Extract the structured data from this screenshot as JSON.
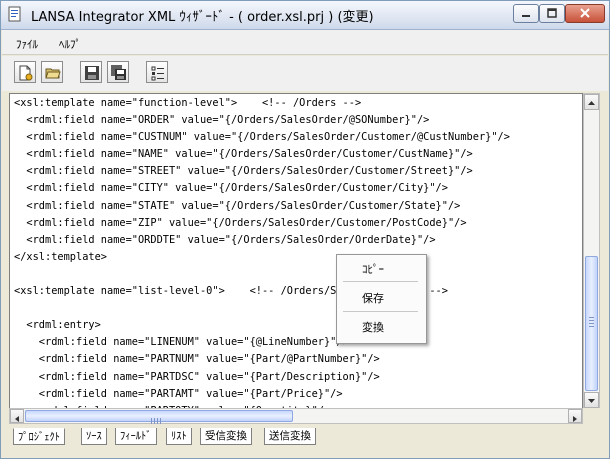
{
  "window": {
    "title": "LANSA Integrator XML ｳｨｻﾞｰﾄﾞ - ( order.xsl.prj ) (変更)"
  },
  "menu": {
    "file": "ﾌｧｲﾙ",
    "help": "ﾍﾙﾌﾟ"
  },
  "toolbar": {
    "buttons": [
      "new-project-icon",
      "open-folder-icon",
      "save-icon",
      "save-all-icon",
      "properties-list-icon"
    ]
  },
  "editor": {
    "lines": [
      "<xsl:template name=\"function-level\">    <!-- /Orders -->",
      "  <rdml:field name=\"ORDER\" value=\"{/Orders/SalesOrder/@SONumber}\"/>",
      "  <rdml:field name=\"CUSTNUM\" value=\"{/Orders/SalesOrder/Customer/@CustNumber}\"/>",
      "  <rdml:field name=\"NAME\" value=\"{/Orders/SalesOrder/Customer/CustName}\"/>",
      "  <rdml:field name=\"STREET\" value=\"{/Orders/SalesOrder/Customer/Street}\"/>",
      "  <rdml:field name=\"CITY\" value=\"{/Orders/SalesOrder/Customer/City}\"/>",
      "  <rdml:field name=\"STATE\" value=\"{/Orders/SalesOrder/Customer/State}\"/>",
      "  <rdml:field name=\"ZIP\" value=\"{/Orders/SalesOrder/Customer/PostCode}\"/>",
      "  <rdml:field name=\"ORDDTE\" value=\"{/Orders/SalesOrder/OrderDate}\"/>",
      "</xsl:template>",
      "",
      "<xsl:template name=\"list-level-0\">    <!-- /Orders/SalesOrder/Line -->",
      "",
      "  <rdml:entry>",
      "    <rdml:field name=\"LINENUM\" value=\"{@LineNumber}\"/>",
      "    <rdml:field name=\"PARTNUM\" value=\"{Part/@PartNumber}\"/>",
      "    <rdml:field name=\"PARTDSC\" value=\"{Part/Description}\"/>",
      "    <rdml:field name=\"PARTAMT\" value=\"{Part/Price}\"/>",
      "    <rdml:field name=\"PARTQTY\" value=\"{Quantity}\"/>"
    ]
  },
  "context_menu": {
    "copy": "ｺﾋﾟｰ",
    "save": "保存",
    "convert": "変換"
  },
  "tabs": [
    "ﾌﾟﾛｼﾞｪｸﾄ",
    "ｿｰｽ",
    "ﾌｨｰﾙﾄﾞ",
    "ﾘｽﾄ",
    "受信変換",
    "送信変換"
  ]
}
